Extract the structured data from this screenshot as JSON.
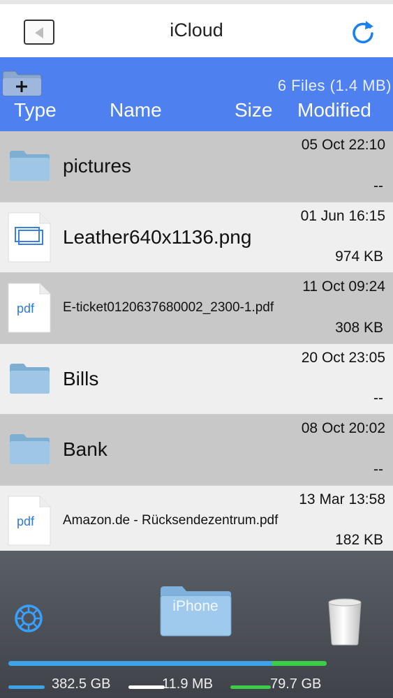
{
  "nav": {
    "title": "iCloud",
    "back_icon": "back-arrow-icon",
    "refresh_icon": "refresh-icon"
  },
  "header": {
    "file_count": "6 Files  (1.4 MB)",
    "columns": {
      "type": "Type",
      "name": "Name",
      "size": "Size",
      "modified": "Modified"
    }
  },
  "files": [
    {
      "name": "pictures",
      "date": "05 Oct 22:10",
      "size": "--",
      "icon": "folder-icon"
    },
    {
      "name": "Leather640x1136.png",
      "date": "01 Jun 16:15",
      "size": "974 KB",
      "icon": "image-file-icon"
    },
    {
      "name": "E-ticket0120637680002_2300-1.pdf",
      "date": "11 Oct 09:24",
      "size": "308 KB",
      "icon": "pdf-file-icon",
      "badge": "pdf"
    },
    {
      "name": "Bills",
      "date": "20 Oct 23:05",
      "size": "--",
      "icon": "folder-icon"
    },
    {
      "name": "Bank",
      "date": "08 Oct 20:02",
      "size": "--",
      "icon": "folder-icon"
    },
    {
      "name": "Amazon.de - Rücksendezentrum.pdf",
      "date": "13 Mar 13:58",
      "size": "182 KB",
      "icon": "pdf-file-icon",
      "badge": "pdf"
    }
  ],
  "bottom": {
    "device_label": "iPhone",
    "storage": {
      "total": "382.5 GB",
      "used": "11.9 MB",
      "free": "79.7 GB"
    },
    "used_fraction": 0.83
  },
  "colors": {
    "header": "#4e80f0",
    "accent": "#1a7ff0",
    "storage_blue": "#3ea2e8",
    "storage_green": "#3ccc45"
  }
}
